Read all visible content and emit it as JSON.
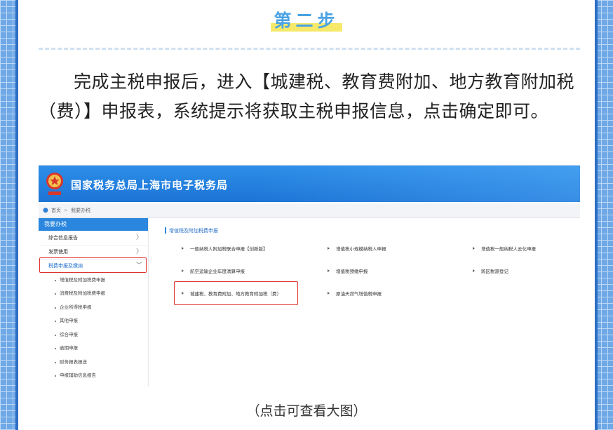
{
  "step_title": "第二步",
  "instruction": "完成主税申报后，进入【城建税、教育费附加、地方教育附加税（费）】申报表，系统提示将获取主税申报信息，点击确定即可。",
  "caption": "（点击可查看大图）",
  "screenshot": {
    "site_title": "国家税务总局上海市电子税务局",
    "breadcrumb": {
      "home": "首页",
      "separator": ">",
      "current": "我要办税"
    },
    "sidebar": {
      "header": "我要办税",
      "items": [
        {
          "label": "综合信息报告",
          "chevron": "〉"
        },
        {
          "label": "发票使用",
          "chevron": "〉"
        },
        {
          "label": "税费申报及缴纳",
          "chevron": "﹀"
        }
      ],
      "sub_items": [
        "增值税及附加税费申报",
        "消费税及附加税费申报",
        "企业所得税申报",
        "其他申报",
        "综合申报",
        "逾期申报",
        "财务报表报送",
        "申报辅助信息报告"
      ]
    },
    "section_title": "增值税及附加税费申报",
    "links": [
      "一般纳税人附加税联合申报【创新版】",
      "增值税小规模纳税人申报",
      "增值税一般纳税人云化申报",
      "航空运输企业年度清算申报",
      "增值税预缴申报",
      "跨区税源登记",
      "城建税、教育费附加、地方教育附加税（费）",
      "原油天然气增值税申报"
    ]
  },
  "colors": {
    "step_title": "#4aa3e3",
    "highlight": "#f6e96a",
    "header_blue": "#1d74d6",
    "red_box": "#e0312d"
  }
}
